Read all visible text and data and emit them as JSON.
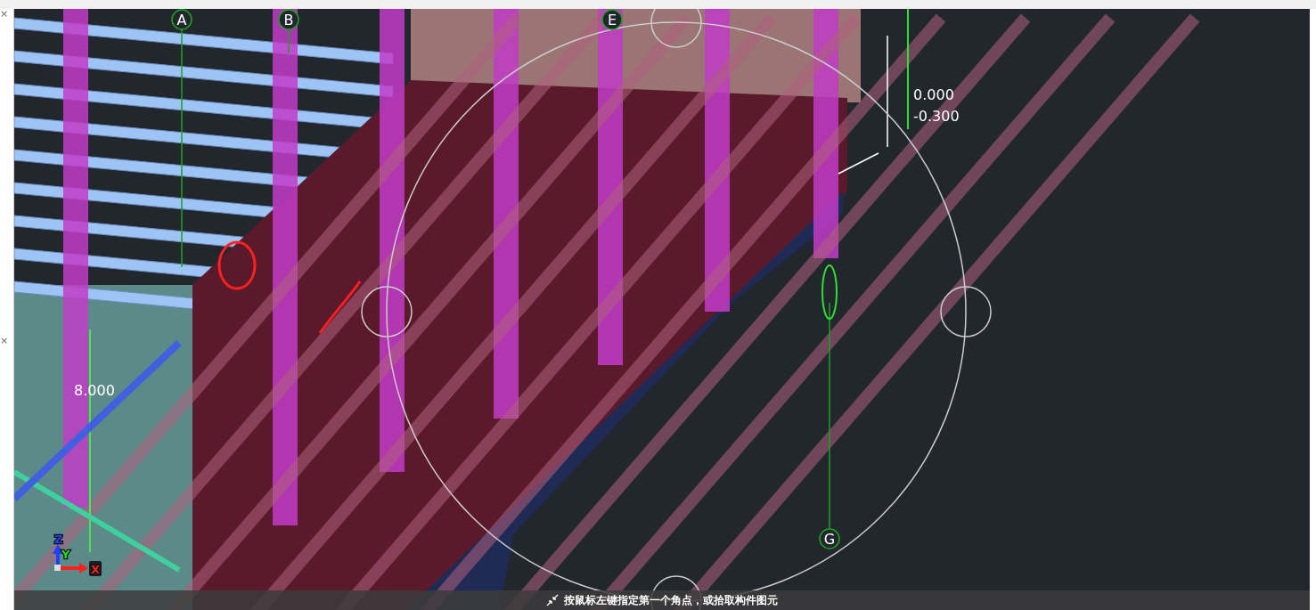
{
  "left_panel": {
    "close_buttons": [
      "×",
      "×"
    ]
  },
  "viewport": {
    "grid_axes": [
      {
        "label": "A"
      },
      {
        "label": "B"
      },
      {
        "label": "E"
      },
      {
        "label": "G"
      }
    ],
    "elevations": [
      "0.000",
      "-0.300",
      "8.000"
    ],
    "axis_labels": [
      "X",
      "Y",
      "Z"
    ]
  },
  "status_bar": {
    "prompt": "按鼠标左键指定第一个角点，或拾取构件图元"
  }
}
